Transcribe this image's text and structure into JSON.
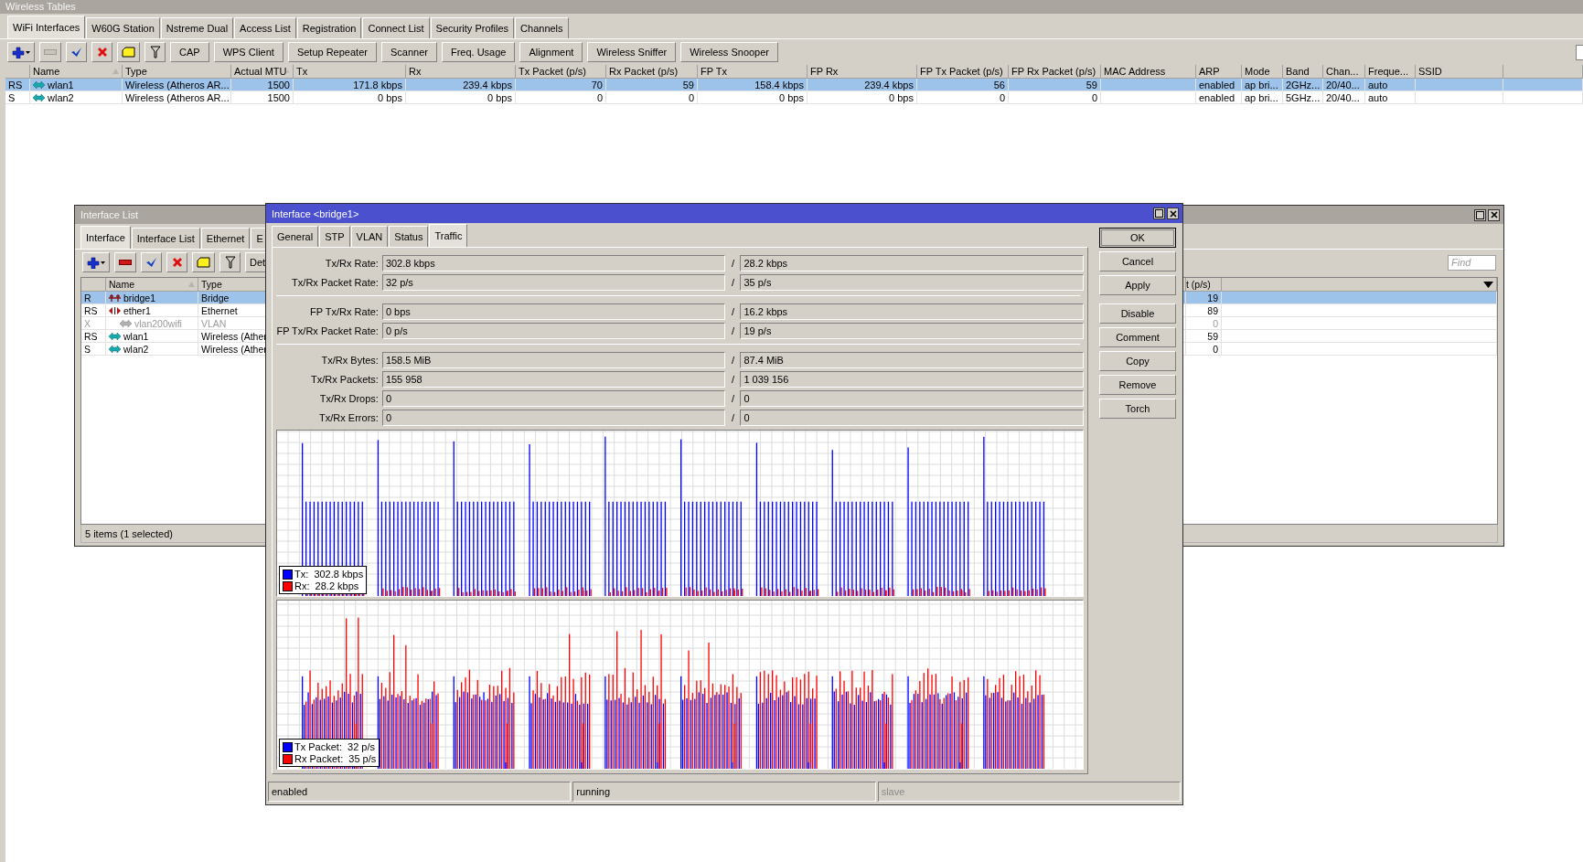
{
  "wireless_tables": {
    "title": "Wireless Tables",
    "tabs": [
      {
        "label": "WiFi Interfaces",
        "selected": true
      },
      {
        "label": "W60G Station",
        "selected": false
      },
      {
        "label": "Nstreme Dual",
        "selected": false
      },
      {
        "label": "Access List",
        "selected": false
      },
      {
        "label": "Registration",
        "selected": false
      },
      {
        "label": "Connect List",
        "selected": false
      },
      {
        "label": "Security Profiles",
        "selected": false
      },
      {
        "label": "Channels",
        "selected": false
      }
    ],
    "toolbar": {
      "remove_disabled": true,
      "buttons": [
        "CAP",
        "WPS Client",
        "Setup Repeater",
        "Scanner",
        "Freq. Usage",
        "Alignment",
        "Wireless Sniffer",
        "Wireless Snooper"
      ]
    },
    "table": {
      "columns": [
        {
          "label": "Name",
          "sorted": true
        },
        {
          "label": "Type",
          "sorted": false
        },
        {
          "label": "Actual MTU",
          "sorted": true
        },
        {
          "label": "Tx",
          "sorted": false
        },
        {
          "label": "Rx",
          "sorted": false
        },
        {
          "label": "Tx Packet (p/s)",
          "sorted": false
        },
        {
          "label": "Rx Packet (p/s)",
          "sorted": false
        },
        {
          "label": "FP Tx",
          "sorted": false
        },
        {
          "label": "FP Rx",
          "sorted": false
        },
        {
          "label": "FP Tx Packet (p/s)",
          "sorted": false
        },
        {
          "label": "FP Rx Packet (p/s)",
          "sorted": false
        },
        {
          "label": "MAC Address",
          "sorted": false
        },
        {
          "label": "ARP",
          "sorted": false
        },
        {
          "label": "Mode",
          "sorted": false
        },
        {
          "label": "Band",
          "sorted": false
        },
        {
          "label": "Chan...",
          "sorted": false
        },
        {
          "label": "Freque...",
          "sorted": false
        },
        {
          "label": "SSID",
          "sorted": false
        }
      ],
      "rows": [
        {
          "selected": true,
          "kind": "wireless",
          "flags": "RS",
          "cells": [
            "wlan1",
            "Wireless (Atheros AR...",
            "1500",
            "171.8 kbps",
            "239.4 kbps",
            "70",
            "59",
            "158.4 kbps",
            "239.4 kbps",
            "56",
            "59",
            null,
            "enabled",
            "ap bri...",
            "2GHz...",
            "20/40...",
            "auto",
            null
          ]
        },
        {
          "selected": false,
          "kind": "wireless",
          "flags": "S",
          "cells": [
            "wlan2",
            "Wireless (Atheros AR...",
            "1500",
            "0 bps",
            "0 bps",
            "0",
            "0",
            "0 bps",
            "0 bps",
            "0",
            "0",
            null,
            "enabled",
            "ap bri...",
            "5GHz...",
            "20/40...",
            "auto",
            null
          ]
        }
      ]
    }
  },
  "interface_list": {
    "title": "Interface List",
    "tabs": [
      {
        "label": "Interface",
        "selected": true
      },
      {
        "label": "Interface List",
        "selected": false
      },
      {
        "label": "Ethernet",
        "selected": false
      },
      {
        "label": "E",
        "selected": false
      }
    ],
    "toolbar": {
      "remove_disabled": false,
      "buttons": [
        "Det"
      ]
    },
    "search": {
      "placeholder": "Find"
    },
    "table": {
      "columns": [
        null,
        "Name",
        "Type",
        "t (p/s)"
      ],
      "rows": [
        {
          "flags": "R",
          "name": "bridge1",
          "type": "Bridge",
          "value": "19",
          "kind": "bridge",
          "selected": true,
          "disabled": false
        },
        {
          "flags": "RS",
          "name": "ether1",
          "type": "Ethernet",
          "value": "89",
          "kind": "ethernet",
          "selected": false,
          "disabled": false,
          "children": [
            {
              "flags": "X",
              "name": "vlan200wifi",
              "type": "VLAN",
              "value": "0",
              "kind": "vlan",
              "selected": false,
              "disabled": true
            }
          ]
        },
        {
          "flags": "RS",
          "name": "wlan1",
          "type": "Wireless (Ather",
          "value": "59",
          "kind": "wireless",
          "selected": false,
          "disabled": false
        },
        {
          "flags": "S",
          "name": "wlan2",
          "type": "Wireless (Ather",
          "value": "0",
          "kind": "wireless",
          "selected": false,
          "disabled": false
        }
      ]
    },
    "status": "5 items (1 selected)"
  },
  "dialog": {
    "title": "Interface <bridge1>",
    "tabs": [
      {
        "label": "General",
        "selected": false
      },
      {
        "label": "STP",
        "selected": false
      },
      {
        "label": "VLAN",
        "selected": false
      },
      {
        "label": "Status",
        "selected": false
      },
      {
        "label": "Traffic",
        "selected": true
      }
    ],
    "field_groups": [
      [
        {
          "label": "Tx/Rx Rate:",
          "tx": "302.8 kbps",
          "rx": "28.2 kbps"
        },
        {
          "label": "Tx/Rx Packet Rate:",
          "tx": "32 p/s",
          "rx": "35 p/s"
        }
      ],
      [
        {
          "label": "FP Tx/Rx Rate:",
          "tx": "0 bps",
          "rx": "16.2 kbps"
        },
        {
          "label": "FP Tx/Rx Packet Rate:",
          "tx": "0 p/s",
          "rx": "19 p/s"
        }
      ],
      [
        {
          "label": "Tx/Rx Bytes:",
          "tx": "158.5 MiB",
          "rx": "87.4 MiB"
        },
        {
          "label": "Tx/Rx Packets:",
          "tx": "155 958",
          "rx": "1 039 156"
        },
        {
          "label": "Tx/Rx Drops:",
          "tx": "0",
          "rx": "0"
        },
        {
          "label": "Tx/Rx Errors:",
          "tx": "0",
          "rx": "0"
        }
      ]
    ],
    "separator": "/",
    "graphs": [
      {
        "kind": "rate",
        "legend": [
          {
            "label": "Tx:",
            "value": "302.8 kbps",
            "color": "#0000ff"
          },
          {
            "label": "Rx:",
            "value": "28.2 kbps",
            "color": "#ff0000"
          }
        ]
      },
      {
        "kind": "packets",
        "legend": [
          {
            "label": "Tx Packet:",
            "value": "32 p/s",
            "color": "#0000ff"
          },
          {
            "label": "Rx Packet:",
            "value": "35 p/s",
            "color": "#ff0000"
          }
        ]
      }
    ],
    "button_groups": [
      [
        {
          "label": "OK",
          "default": true
        },
        {
          "label": "Cancel",
          "default": false
        },
        {
          "label": "Apply",
          "default": false
        }
      ],
      [
        {
          "label": "Disable",
          "default": false
        },
        {
          "label": "Comment",
          "default": false
        },
        {
          "label": "Copy",
          "default": false
        },
        {
          "label": "Remove",
          "default": false
        },
        {
          "label": "Torch",
          "default": false
        }
      ]
    ],
    "status": [
      {
        "text": "enabled",
        "disabled": false
      },
      {
        "text": "running",
        "disabled": false
      },
      {
        "text": "slave",
        "disabled": true
      }
    ]
  }
}
